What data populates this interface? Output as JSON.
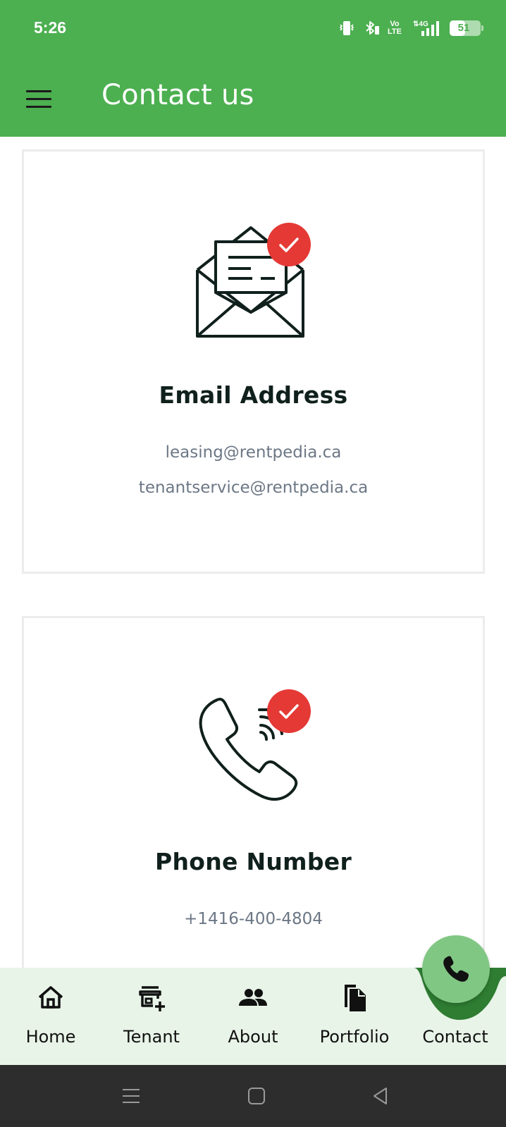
{
  "status_bar": {
    "time": "5:26",
    "volte_label": "Vo\nLTE",
    "network": "4G",
    "battery_level": "51",
    "battery_fraction": 0.51
  },
  "app_bar": {
    "title": "Contact us",
    "menu_icon": "hamburger-menu-icon",
    "background_color": "#4caf50"
  },
  "email_card": {
    "icon": "envelope-check-icon",
    "heading": "Email Address",
    "lines": [
      "leasing@rentpedia.ca",
      "tenantservice@rentpedia.ca"
    ]
  },
  "phone_card": {
    "icon": "phone-check-icon",
    "heading": "Phone Number",
    "lines": [
      "+1416-400-4804"
    ]
  },
  "bottom_nav": {
    "items": [
      {
        "label": "Home",
        "icon": "home-icon"
      },
      {
        "label": "Tenant",
        "icon": "storefront-add-icon"
      },
      {
        "label": "About",
        "icon": "people-icon"
      },
      {
        "label": "Portfolio",
        "icon": "documents-icon"
      },
      {
        "label": "Contact",
        "icon": "phone-icon",
        "active": true
      }
    ],
    "background_color": "#e8f4e8",
    "accent_color": "#2e7d32",
    "fab_color": "#81c784"
  },
  "colors": {
    "badge_red": "#e53935",
    "heading_text": "#10201c",
    "body_text": "#6c7785"
  }
}
